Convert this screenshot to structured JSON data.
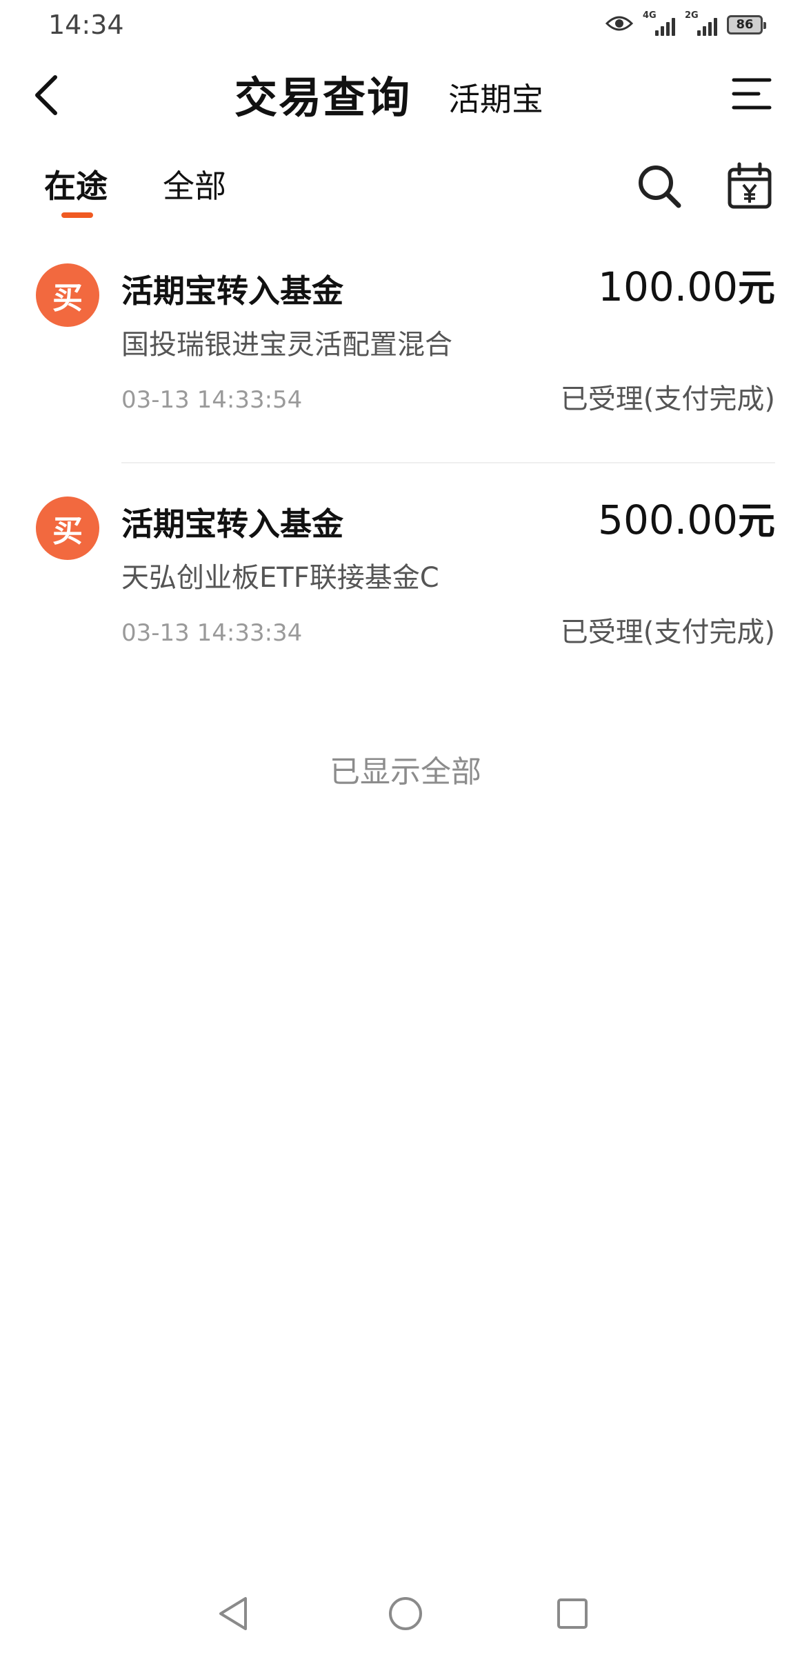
{
  "status_bar": {
    "time": "14:34",
    "network_1": "4G",
    "network_2": "2G",
    "battery": "86",
    "icons": [
      "eye-icon",
      "signal-icon",
      "signal-icon",
      "battery-icon"
    ]
  },
  "header": {
    "title": "交易查询",
    "subtitle": "活期宝",
    "back_icon": "chevron-left-icon",
    "menu_icon": "menu-lines-icon"
  },
  "tabs": [
    {
      "label": "在途",
      "active": true
    },
    {
      "label": "全部",
      "active": false
    }
  ],
  "toolbar": {
    "search_icon": "search-icon",
    "calendar_icon": "calendar-yen-icon"
  },
  "transactions": [
    {
      "badge": "买",
      "title": "活期宝转入基金",
      "amount": "100.00",
      "unit": "元",
      "fund": "国投瑞银进宝灵活配置混合",
      "time": "03-13 14:33:54",
      "status": "已受理(支付完成)"
    },
    {
      "badge": "买",
      "title": "活期宝转入基金",
      "amount": "500.00",
      "unit": "元",
      "fund": "天弘创业板ETF联接基金C",
      "time": "03-13 14:33:34",
      "status": "已受理(支付完成)"
    }
  ],
  "list_end_note": "已显示全部",
  "nav_bar": {
    "icons": [
      "nav-back-icon",
      "nav-home-icon",
      "nav-recent-icon"
    ]
  },
  "colors": {
    "accent": "#f05a22",
    "badge": "#f2693f",
    "secondary_text": "#555555",
    "muted_text": "#9a9a9a"
  }
}
